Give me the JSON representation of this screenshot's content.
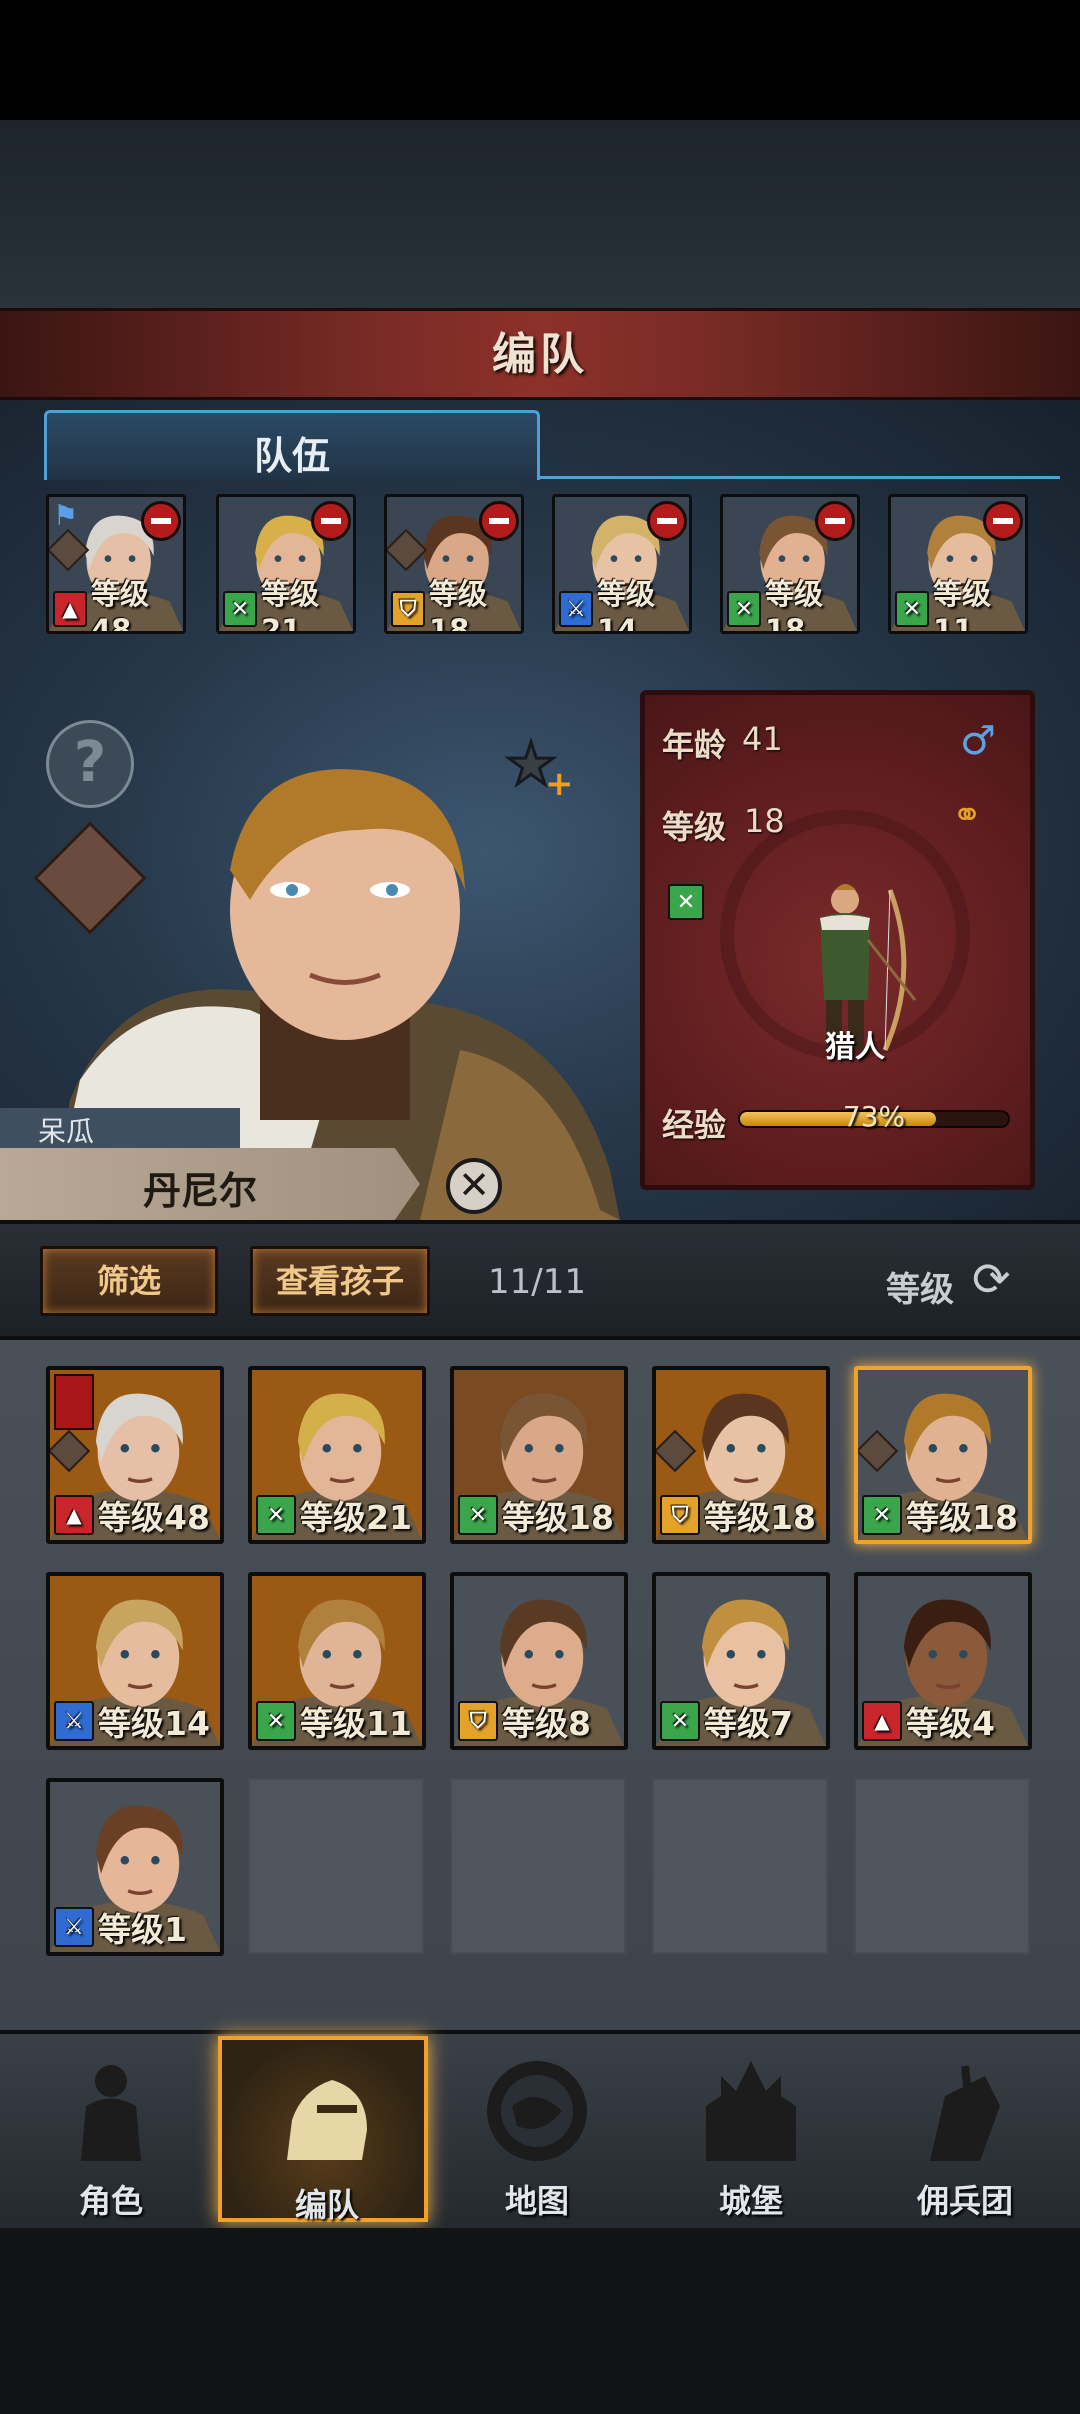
{
  "title": "编队",
  "tab": {
    "label": "队伍"
  },
  "team": [
    {
      "level": "等级48",
      "role": "beast",
      "leader": true
    },
    {
      "level": "等级21",
      "role": "hunter"
    },
    {
      "level": "等级18",
      "role": "guard"
    },
    {
      "level": "等级14",
      "role": "sword"
    },
    {
      "level": "等级18",
      "role": "hunter"
    },
    {
      "level": "等级11",
      "role": "hunter"
    }
  ],
  "character": {
    "nickname": "呆瓜",
    "name": "丹尼尔",
    "age_label": "年龄",
    "age": "41",
    "level_label": "等级",
    "level": "18",
    "class": "猎人",
    "exp_label": "经验",
    "exp_percent": 73,
    "exp_text": "73%"
  },
  "toolbar": {
    "filter_label": "筛选",
    "children_label": "查看孩子",
    "count": "11/11",
    "sort_label": "等级"
  },
  "roster": [
    {
      "level": "等级48",
      "role": "beast"
    },
    {
      "level": "等级21",
      "role": "hunter"
    },
    {
      "level": "等级18",
      "role": "hunter"
    },
    {
      "level": "等级18",
      "role": "guard"
    },
    {
      "level": "等级18",
      "role": "hunter",
      "selected": true
    },
    {
      "level": "等级14",
      "role": "sword"
    },
    {
      "level": "等级11",
      "role": "hunter"
    },
    {
      "level": "等级8",
      "role": "guard"
    },
    {
      "level": "等级7",
      "role": "hunter"
    },
    {
      "level": "等级4",
      "role": "beast"
    },
    {
      "level": "等级1",
      "role": "sword"
    }
  ],
  "nav": [
    {
      "label": "角色",
      "icon": "knight-icon"
    },
    {
      "label": "编队",
      "icon": "helmet-icon",
      "active": true
    },
    {
      "label": "地图",
      "icon": "compass-map-icon"
    },
    {
      "label": "城堡",
      "icon": "castle-icon"
    },
    {
      "label": "佣兵团",
      "icon": "mercenary-icon"
    }
  ],
  "colors": {
    "accent": "#f1a12a",
    "tab_border": "#4ea0d8",
    "banner": "#8c3129"
  }
}
